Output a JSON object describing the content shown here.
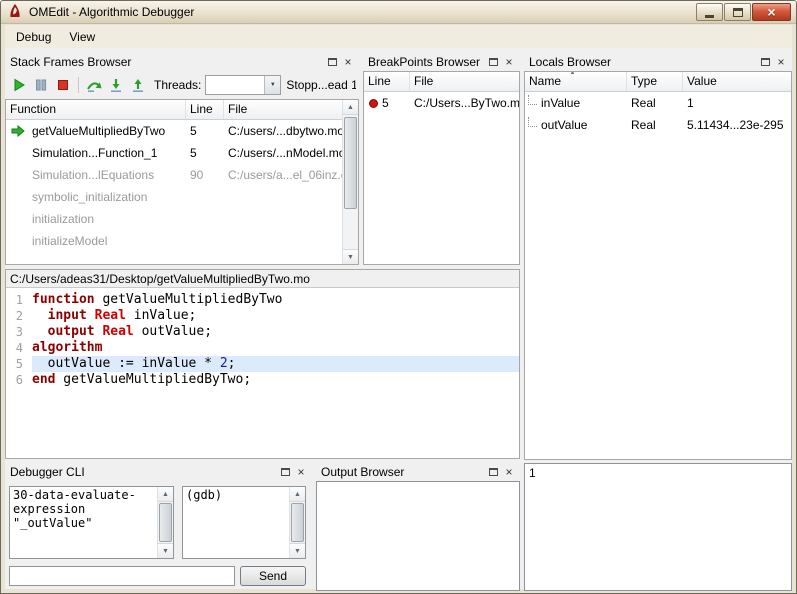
{
  "window": {
    "title": "OMEdit - Algorithmic Debugger",
    "menus": [
      {
        "label": "Debug"
      },
      {
        "label": "View"
      }
    ]
  },
  "stack_frames_browser": {
    "title": "Stack Frames Browser",
    "toolbar": {
      "threads_label": "Threads:",
      "thread_value": "",
      "status": "Stopp...ead 1"
    },
    "columns": [
      "Function",
      "Line",
      "File"
    ],
    "rows": [
      {
        "function": "getValueMultipliedByTwo",
        "line": "5",
        "file": "C:/users/...dbytwo.mo",
        "current": true,
        "dimmed": false
      },
      {
        "function": "Simulation...Function_1",
        "line": "5",
        "file": "C:/users/...nModel.mo",
        "current": false,
        "dimmed": false
      },
      {
        "function": "Simulation...lEquations",
        "line": "90",
        "file": "C:/users/a...el_06inz.c",
        "current": false,
        "dimmed": true
      },
      {
        "function": "symbolic_initialization",
        "line": "",
        "file": "",
        "current": false,
        "dimmed": true
      },
      {
        "function": "initialization",
        "line": "",
        "file": "",
        "current": false,
        "dimmed": true
      },
      {
        "function": "initializeModel",
        "line": "",
        "file": "",
        "current": false,
        "dimmed": true
      }
    ]
  },
  "breakpoints_browser": {
    "title": "BreakPoints Browser",
    "columns": [
      "Line",
      "File"
    ],
    "rows": [
      {
        "line": "5",
        "file": "C:/Users...ByTwo.mo"
      }
    ]
  },
  "locals_browser": {
    "title": "Locals Browser",
    "columns": [
      "Name",
      "Type",
      "Value"
    ],
    "rows": [
      {
        "name": "inValue",
        "type": "Real",
        "value": "1"
      },
      {
        "name": "outValue",
        "type": "Real",
        "value": "5.11434...23e-295"
      }
    ]
  },
  "editor": {
    "path": "C:/Users/adeas31/Desktop/getValueMultipliedByTwo.mo",
    "current_line": 5,
    "lines": [
      {
        "num": "1",
        "segments": [
          {
            "c": "kw",
            "t": "function"
          },
          {
            "c": "pl",
            "t": " getValueMultipliedByTwo"
          }
        ]
      },
      {
        "num": "2",
        "segments": [
          {
            "c": "pl",
            "t": "  "
          },
          {
            "c": "kw",
            "t": "input"
          },
          {
            "c": "pl",
            "t": " "
          },
          {
            "c": "ty",
            "t": "Real"
          },
          {
            "c": "pl",
            "t": " inValue;"
          }
        ]
      },
      {
        "num": "3",
        "segments": [
          {
            "c": "pl",
            "t": "  "
          },
          {
            "c": "kw",
            "t": "output"
          },
          {
            "c": "pl",
            "t": " "
          },
          {
            "c": "ty",
            "t": "Real"
          },
          {
            "c": "pl",
            "t": " outValue;"
          }
        ]
      },
      {
        "num": "4",
        "segments": [
          {
            "c": "kw",
            "t": "algorithm"
          }
        ]
      },
      {
        "num": "5",
        "segments": [
          {
            "c": "pl",
            "t": "  outValue := inValue * "
          },
          {
            "c": "nu",
            "t": "2"
          },
          {
            "c": "pl",
            "t": ";"
          }
        ]
      },
      {
        "num": "6",
        "segments": [
          {
            "c": "kw",
            "t": "end"
          },
          {
            "c": "pl",
            "t": " getValueMultipliedByTwo;"
          }
        ]
      }
    ]
  },
  "debugger_cli": {
    "title": "Debugger CLI",
    "command_history": "30-data-evaluate-expression \"_outValue\"",
    "response": "(gdb)",
    "input_value": "",
    "send_label": "Send"
  },
  "output_browser": {
    "title": "Output Browser"
  },
  "locals_value_viewer": {
    "value": "1"
  },
  "icons": {
    "resume_icon": "green play triangle",
    "interrupt_icon": "pause bars",
    "stop_icon": "red square",
    "step_over_icon": "green curved arrow over line",
    "step_into_icon": "green down arrow into line",
    "step_return_icon": "green up arrow from line",
    "float_icon": "window outline",
    "close_icon": "×",
    "breakpoint_icon": "red dot",
    "current_frame_icon": "green right arrow",
    "sort_icon": "▲",
    "combo_arrow_icon": "▼"
  },
  "colors": {
    "keyword": "#8b0000",
    "type": "#d00000",
    "number": "#1a1aa6",
    "current_line_bg": "#dcebfb",
    "breakpoint_red": "#cc1414",
    "arrow_green": "#1ca81c",
    "dimmed_text": "#9a9a9a"
  }
}
